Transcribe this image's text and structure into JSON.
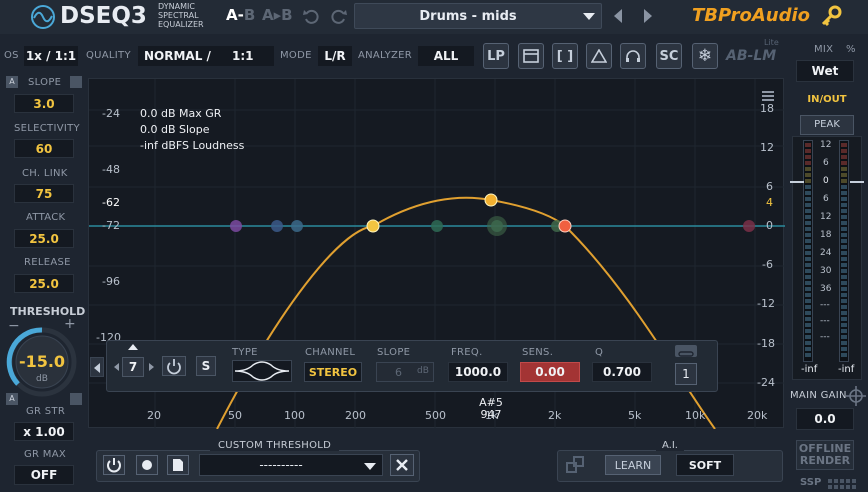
{
  "topbar": {
    "logo_name": "DSEQ3",
    "logo_sub1": "DYNAMIC",
    "logo_sub2": "SPECTRAL",
    "logo_sub3": "EQUALIZER",
    "ab_label": "A-B",
    "ab_a": "A",
    "ab_b": "B",
    "preset": "Drums - mids",
    "brand": "TBProAudio"
  },
  "row2": {
    "os_label": "OS",
    "os_value": "1x / 1:1",
    "quality_label": "QUALITY",
    "quality_value": "NORMAL /",
    "quality_ratio": "1:1",
    "mode_label": "MODE",
    "mode_value": "L/R",
    "analyzer_label": "ANALYZER",
    "analyzer_value": "ALL",
    "buttons": [
      "LP",
      "SC"
    ],
    "ablm": "AB-LM",
    "ablm_lite": "Lite"
  },
  "left": {
    "slope_label": "SLOPE",
    "slope_value": "3.0",
    "selectivity_label": "SELECTIVITY",
    "selectivity_value": "60",
    "chlink_label": "CH. LINK",
    "chlink_value": "75",
    "attack_label": "ATTACK",
    "attack_value": "25.0",
    "release_label": "RELEASE",
    "release_value": "25.0",
    "threshold_label": "THRESHOLD",
    "threshold_value": "-15.0",
    "threshold_unit": "dB",
    "grstr_label": "GR STR",
    "grstr_value": "x 1.00",
    "grmax_label": "GR MAX",
    "grmax_value": "OFF",
    "a_tag": "A"
  },
  "graph": {
    "left_ticks": [
      "-24",
      "-48",
      "-62",
      "-72",
      "-96",
      "-120"
    ],
    "right_ticks": [
      "18",
      "12",
      "6",
      "4",
      "0",
      "-6",
      "-12",
      "-18",
      "-24"
    ],
    "freq_ticks": [
      "20",
      "50",
      "100",
      "200",
      "500",
      "1k",
      "2k",
      "5k",
      "10k",
      "20k"
    ],
    "info1": "0.0 dB Max GR",
    "info2": "0.0 dB Slope",
    "info3": "-inf dBFS Loudness",
    "note": "A#5",
    "note_freq": "947"
  },
  "band": {
    "number": "7",
    "s_label": "S",
    "type_label": "TYPE",
    "channel_label": "CHANNEL",
    "channel_value": "STEREO",
    "slope_label": "SLOPE",
    "slope_value": "6",
    "slope_unit": "dB",
    "freq_label": "FREQ.",
    "freq_value": "1000.0",
    "sens_label": "SENS.",
    "sens_value": "0.00",
    "q_label": "Q",
    "q_value": "0.700",
    "link_value": "1"
  },
  "bottom": {
    "custom_threshold_label": "CUSTOM THRESHOLD",
    "custom_threshold_value": "----------",
    "ai_label": "A.I.",
    "learn_label": "LEARN",
    "soft_label": "SOFT"
  },
  "right": {
    "mix_label": "MIX",
    "mix_pct": "%",
    "mix_value": "Wet",
    "inout_label": "IN/OUT",
    "peak_label": "PEAK",
    "meter_scale": [
      "12",
      "6",
      "0",
      "6",
      "12",
      "18",
      "24",
      "30",
      "36",
      "---",
      "---",
      "---"
    ],
    "meter_left_value": "-inf",
    "meter_right_value": "-inf",
    "main_gain_label": "MAIN GAIN",
    "main_gain_value": "0.0",
    "offline_label1": "OFFLINE",
    "offline_label2": "RENDER",
    "ssp_label": "SSP"
  },
  "colors": {
    "accent": "#f2c440",
    "curve": "#e0a030",
    "flatline": "#2b8a9c",
    "sens_red": "#a33434",
    "brand": "#f0a020"
  }
}
